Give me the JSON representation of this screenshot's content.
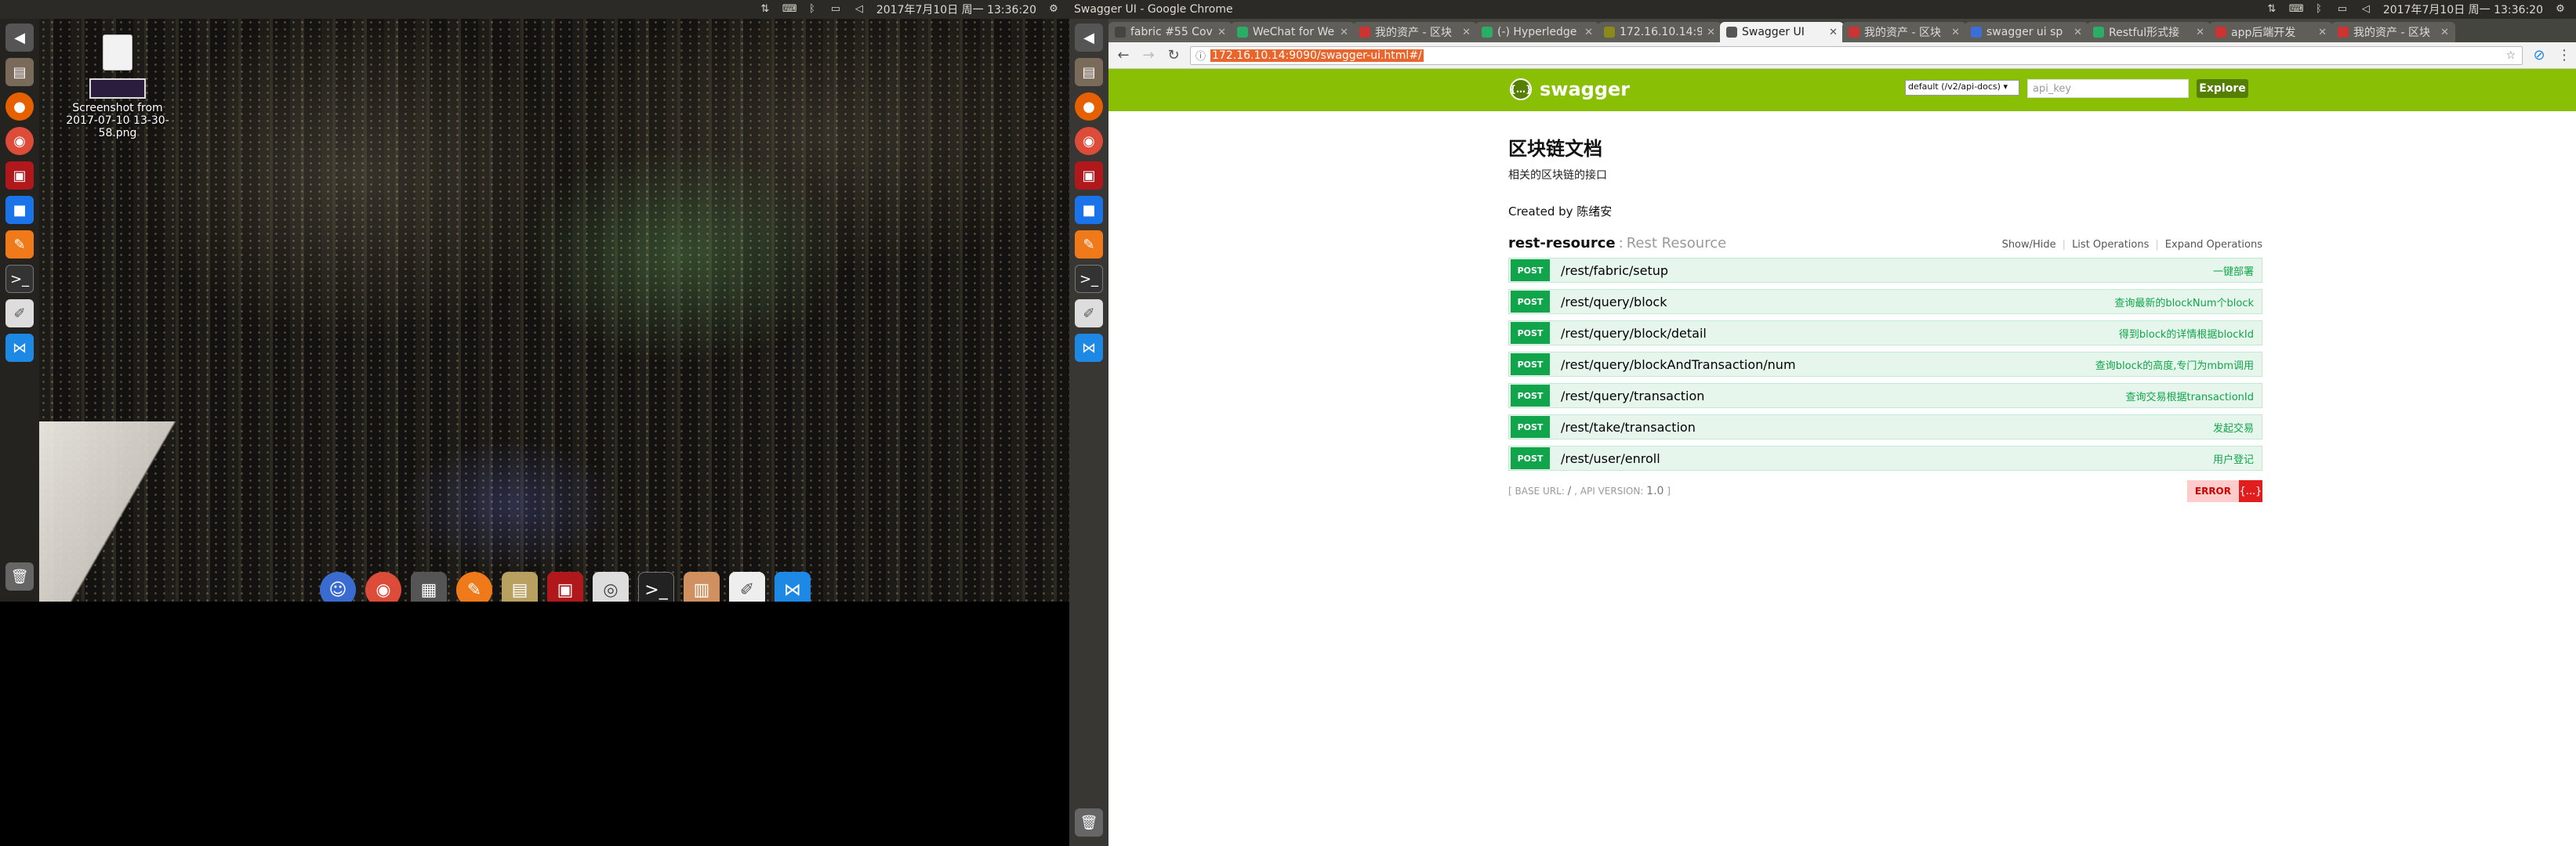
{
  "left_panel": {
    "tray_icons": [
      "network-icon",
      "keyboard-icon",
      "bluetooth-icon",
      "battery-icon",
      "volume-icon"
    ],
    "clock": "2017年7月10日 周一 13:36:20",
    "settings_icon": "gear-icon"
  },
  "desktop": {
    "file_name": "Screenshot from 2017-07-10 13-30-58.png"
  },
  "launcher_icons": [
    "back-icon",
    "files-icon",
    "firefox-icon",
    "chrome-icon",
    "terminal-red-icon",
    "camera-icon",
    "tools-icon",
    "terminal-icon",
    "text-editor-icon",
    "vscode-icon"
  ],
  "dock_icons": [
    "finder-icon",
    "chrome-icon",
    "clapper-icon",
    "pen-icon",
    "notes-icon",
    "slides-icon",
    "disk-icon",
    "terminal-icon",
    "calendar-icon",
    "text-editor-icon",
    "vscode-icon"
  ],
  "window": {
    "title": "Swagger UI - Google Chrome",
    "clock": "2017年7月10日 周一 13:36:20"
  },
  "tabs": [
    {
      "title": "fabric #55 Cov",
      "color": "#444"
    },
    {
      "title": "WeChat for We",
      "color": "#2aae67"
    },
    {
      "title": "我的资产 - 区块",
      "color": "#c33"
    },
    {
      "title": "(-) Hyperledge",
      "color": "#2aae67"
    },
    {
      "title": "172.16.10.14:9",
      "color": "#8a8a1a"
    },
    {
      "title": "Swagger UI",
      "color": "#555",
      "active": true
    },
    {
      "title": "我的资产 - 区块",
      "color": "#c33"
    },
    {
      "title": "swagger ui sp",
      "color": "#3b6fd8"
    },
    {
      "title": "Restful形式接",
      "color": "#2aae67"
    },
    {
      "title": "app后端开发",
      "color": "#c33"
    },
    {
      "title": "我的资产 - 区块",
      "color": "#c33"
    }
  ],
  "toolbar": {
    "url": "172.16.10.14:9090/swagger-ui.html#/"
  },
  "swagger": {
    "logo": "swagger",
    "spec_select": "default (/v2/api-docs)",
    "api_key_placeholder": "api_key",
    "explore": "Explore",
    "title": "区块链文档",
    "description": "相关的区块链的接口",
    "created_by": "Created by 陈绪安",
    "resource": {
      "name": "rest-resource",
      "desc": "Rest Resource",
      "show_hide": "Show/Hide",
      "list_ops": "List Operations",
      "expand_ops": "Expand Operations"
    },
    "operations": [
      {
        "method": "POST",
        "path": "/rest/fabric/setup",
        "summary": "一键部署"
      },
      {
        "method": "POST",
        "path": "/rest/query/block",
        "summary": "查询最新的blockNum个block"
      },
      {
        "method": "POST",
        "path": "/rest/query/block/detail",
        "summary": "得到block的详情根据blockId"
      },
      {
        "method": "POST",
        "path": "/rest/query/blockAndTransaction/num",
        "summary": "查询block的高度,专门为mbm调用"
      },
      {
        "method": "POST",
        "path": "/rest/query/transaction",
        "summary": "查询交易根据transactionId"
      },
      {
        "method": "POST",
        "path": "/rest/take/transaction",
        "summary": "发起交易"
      },
      {
        "method": "POST",
        "path": "/rest/user/enroll",
        "summary": "用户登记"
      }
    ],
    "base_url_label": "BASE URL",
    "base_url": "/",
    "api_version_label": "API VERSION",
    "api_version": "1.0",
    "error_label": "ERROR",
    "error_icon": "{...}"
  }
}
